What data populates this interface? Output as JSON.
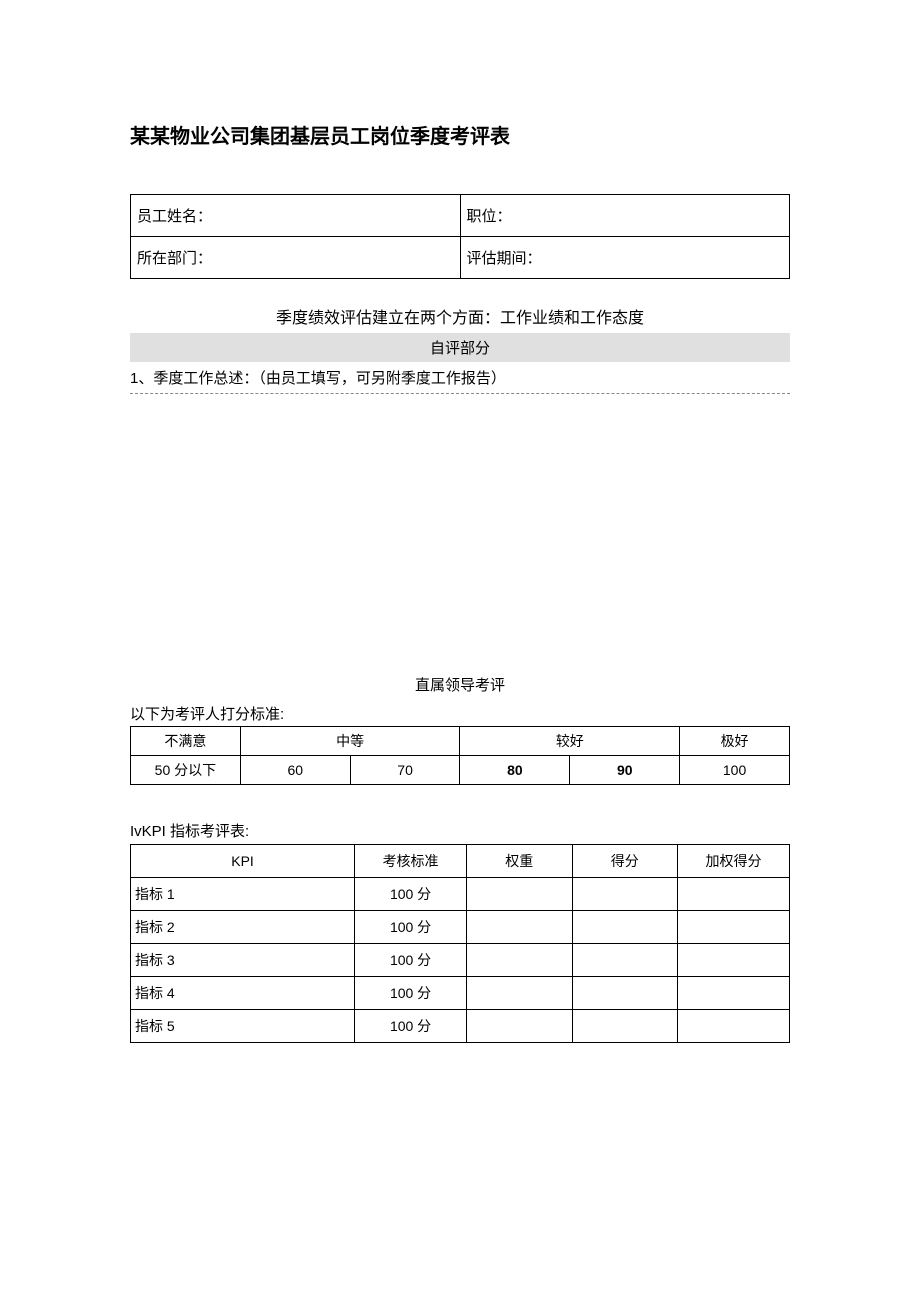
{
  "title": "某某物业公司集团基层员工岗位季度考评表",
  "info": {
    "name_label": "员工姓名：",
    "position_label": "职位：",
    "dept_label": "所在部门：",
    "period_label": "评估期间："
  },
  "subtitle": "季度绩效评估建立在两个方面：工作业绩和工作态度",
  "self_eval_header": "自评部分",
  "instruction": "1、季度工作总述：（由员工填写，可另附季度工作报告）",
  "leader_section_title": "直属领导考评",
  "scoring_standard_label": "以下为考评人打分标准:",
  "scoring": {
    "headers": [
      "不满意",
      "中等",
      "较好",
      "极好"
    ],
    "values": [
      "50 分以下",
      "60",
      "70",
      "80",
      "90",
      "100"
    ]
  },
  "kpi_label": "IvKPI 指标考评表:",
  "kpi": {
    "headers": [
      "KPI",
      "考核标准",
      "权重",
      "得分",
      "加权得分"
    ],
    "rows": [
      {
        "name": "指标 1",
        "standard": "100 分",
        "weight": "",
        "score": "",
        "weighted": ""
      },
      {
        "name": "指标 2",
        "standard": "100 分",
        "weight": "",
        "score": "",
        "weighted": ""
      },
      {
        "name": "指标 3",
        "standard": "100 分",
        "weight": "",
        "score": "",
        "weighted": ""
      },
      {
        "name": "指标 4",
        "standard": "100 分",
        "weight": "",
        "score": "",
        "weighted": ""
      },
      {
        "name": "指标 5",
        "standard": "100 分",
        "weight": "",
        "score": "",
        "weighted": ""
      }
    ]
  }
}
